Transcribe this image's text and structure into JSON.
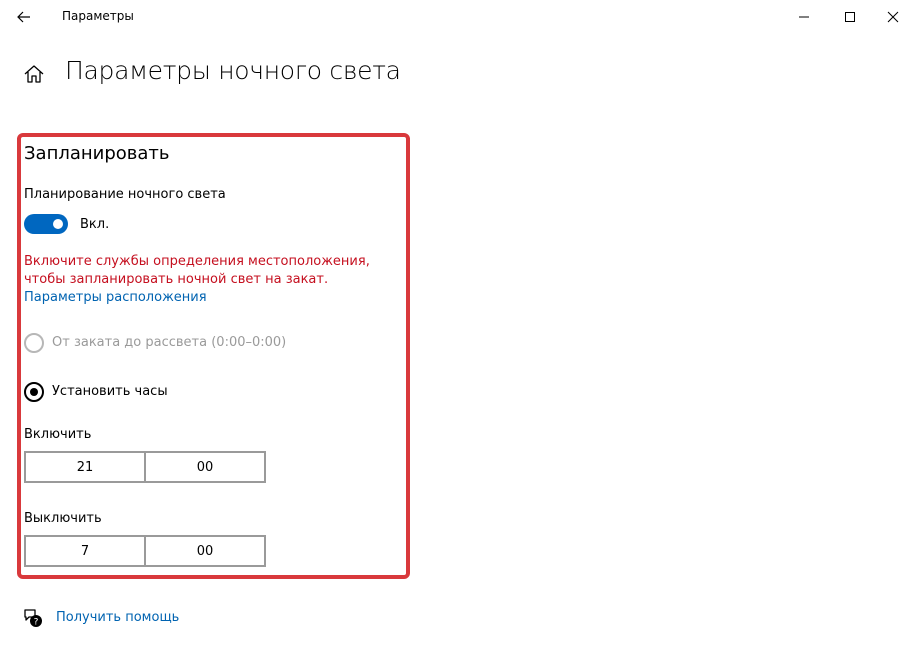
{
  "window": {
    "app_title": "Параметры"
  },
  "page": {
    "title": "Параметры ночного света"
  },
  "schedule": {
    "section_title": "Запланировать",
    "toggle_heading": "Планирование ночного света",
    "toggle_state": "Вкл.",
    "toggle_on": true,
    "warning_text": "Включите службы определения местоположения, чтобы запланировать ночной свет на закат.",
    "location_link": "Параметры расположения",
    "option_sunset": "От заката до рассвета (0:00–0:00)",
    "option_sunset_selected": false,
    "option_sunset_disabled": true,
    "option_hours": "Установить часы",
    "option_hours_selected": true,
    "turn_on_label": "Включить",
    "turn_on_hour": "21",
    "turn_on_minute": "00",
    "turn_off_label": "Выключить",
    "turn_off_hour": "7",
    "turn_off_minute": "00"
  },
  "help": {
    "link_text": "Получить помощь"
  },
  "colors": {
    "accent": "#0067c0",
    "link": "#0063b1",
    "warning": "#c50f1f",
    "highlight_border": "#d9393c"
  },
  "icons": [
    "back-arrow-icon",
    "minimize-icon",
    "maximize-icon",
    "close-icon",
    "home-icon",
    "help-chat-icon"
  ]
}
